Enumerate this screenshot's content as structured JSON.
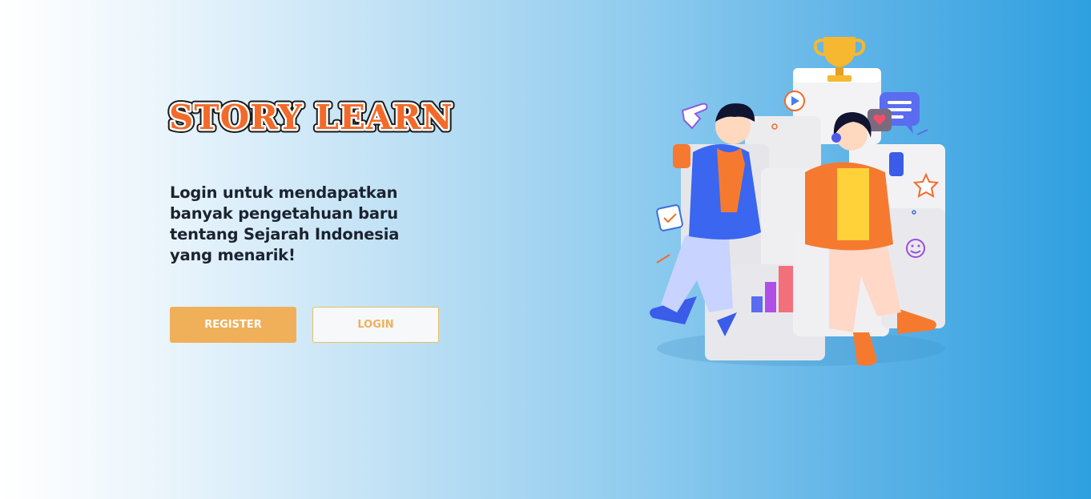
{
  "brand": {
    "logo_text": "STORY LEARN"
  },
  "hero": {
    "tagline": "Login untuk mendapatkan banyak pengetahuan baru tentang Sejarah Indonesia yang menarik!"
  },
  "actions": {
    "register_label": "REGISTER",
    "login_label": "LOGIN"
  },
  "colors": {
    "accent": "#f0b05a",
    "logo_fill": "#f26a2a",
    "background_end": "#2ea0e0"
  },
  "illustration": {
    "icons": [
      "trophy-icon",
      "play-icon",
      "chat-icon",
      "heart-icon",
      "check-icon",
      "star-icon",
      "smile-icon",
      "pointer-hand-icon",
      "bar-chart-icon"
    ]
  }
}
